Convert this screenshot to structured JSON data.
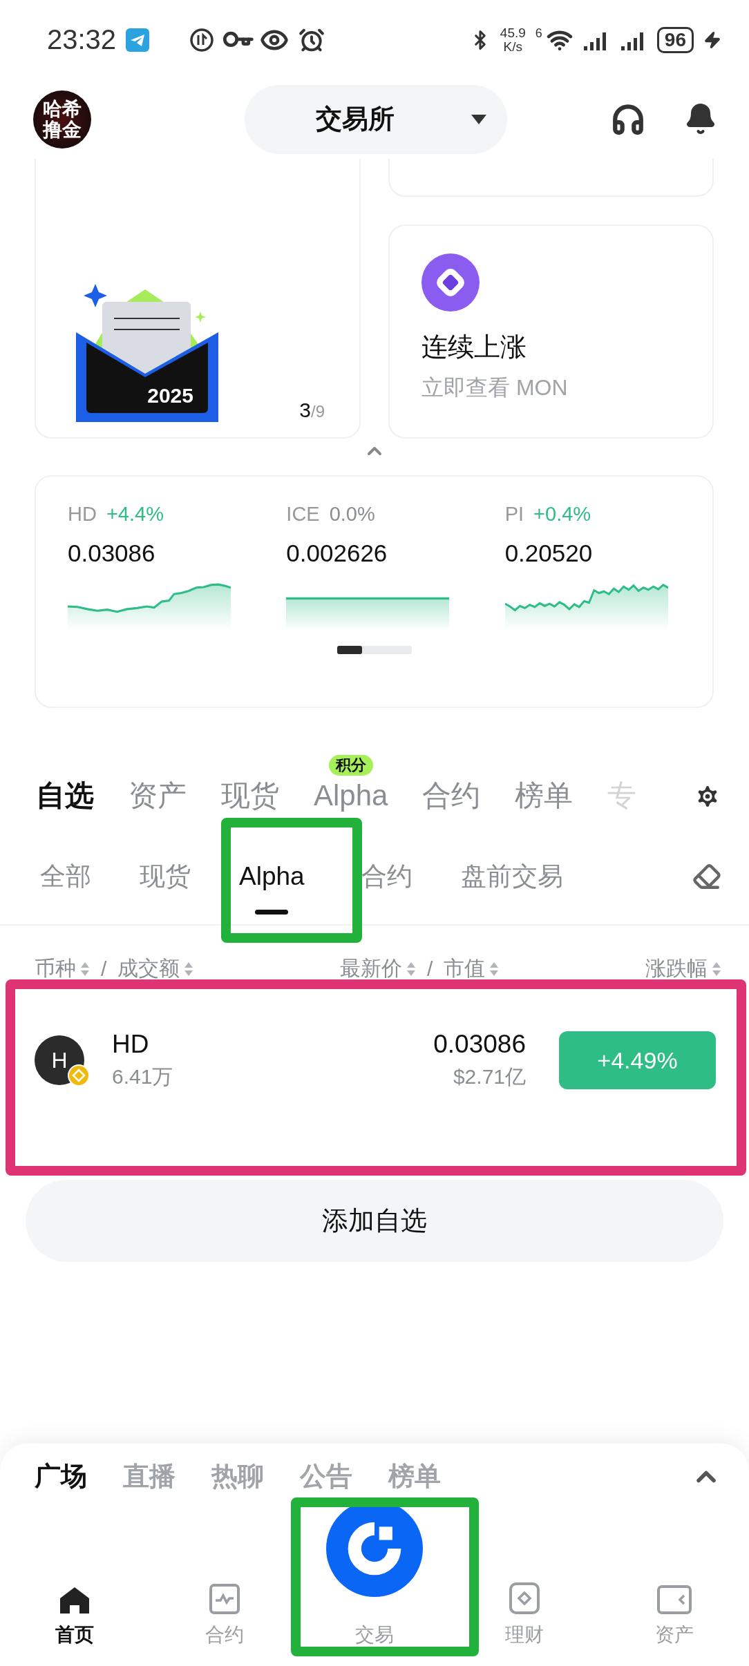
{
  "status_bar": {
    "time": "23:32",
    "net_speed_value": "45.9",
    "net_speed_unit": "K/s",
    "wifi_badge": "6",
    "battery": "96"
  },
  "header": {
    "avatar_lines": [
      "哈希",
      "撸金"
    ],
    "switcher": "交易所"
  },
  "promo": {
    "art_year": "2025",
    "page_current": "3",
    "page_total": "/9"
  },
  "feature_card": {
    "title": "连续上涨",
    "subtitle": "立即查看 MON"
  },
  "tickers": [
    {
      "symbol": "HD",
      "change": "+4.4%",
      "color": "#2ebd85",
      "price": "0.03086"
    },
    {
      "symbol": "ICE",
      "change": "0.0%",
      "color": "#8a8d92",
      "price": "0.002626"
    },
    {
      "symbol": "PI",
      "change": "+0.4%",
      "color": "#2ebd85",
      "price": "0.20520"
    }
  ],
  "main_tabs": [
    {
      "label": "自选",
      "selected": true
    },
    {
      "label": "资产",
      "selected": false
    },
    {
      "label": "现货",
      "selected": false
    },
    {
      "label": "Alpha",
      "selected": false,
      "badge": "积分"
    },
    {
      "label": "合约",
      "selected": false
    },
    {
      "label": "榜单",
      "selected": false
    },
    {
      "label": "专",
      "selected": false,
      "faded": true
    }
  ],
  "sub_tabs": [
    {
      "label": "全部",
      "selected": false
    },
    {
      "label": "现货",
      "selected": false
    },
    {
      "label": "Alpha",
      "selected": true
    },
    {
      "label": "合约",
      "selected": false
    },
    {
      "label": "盘前交易",
      "selected": false
    }
  ],
  "columns": [
    {
      "parts": [
        "币种",
        "成交额"
      ]
    },
    {
      "parts": [
        "最新价",
        "市值"
      ]
    },
    {
      "parts": [
        "涨跌幅"
      ]
    }
  ],
  "column_separator": "/",
  "rows": [
    {
      "symbol": "HD",
      "icon_letter": "H",
      "volume": "6.41万",
      "price": "0.03086",
      "market_cap": "$2.71亿",
      "change": "+4.49%",
      "color": "#2ebd85"
    }
  ],
  "add_button": "添加自选",
  "feed_tabs": [
    {
      "label": "广场",
      "selected": true
    },
    {
      "label": "直播",
      "selected": false
    },
    {
      "label": "热聊",
      "selected": false
    },
    {
      "label": "公告",
      "selected": false
    },
    {
      "label": "榜单",
      "selected": false
    }
  ],
  "nav": [
    {
      "label": "首页",
      "kind": "home",
      "selected": true
    },
    {
      "label": "合约",
      "kind": "chart",
      "selected": false
    },
    {
      "label": "交易",
      "kind": "logo",
      "selected": false
    },
    {
      "label": "理财",
      "kind": "diamond",
      "selected": false
    },
    {
      "label": "资产",
      "kind": "wallet",
      "selected": false
    }
  ],
  "annotations": [
    {
      "color": "#22b13b"
    },
    {
      "color": "#de3473"
    },
    {
      "color": "#22b13b"
    }
  ]
}
